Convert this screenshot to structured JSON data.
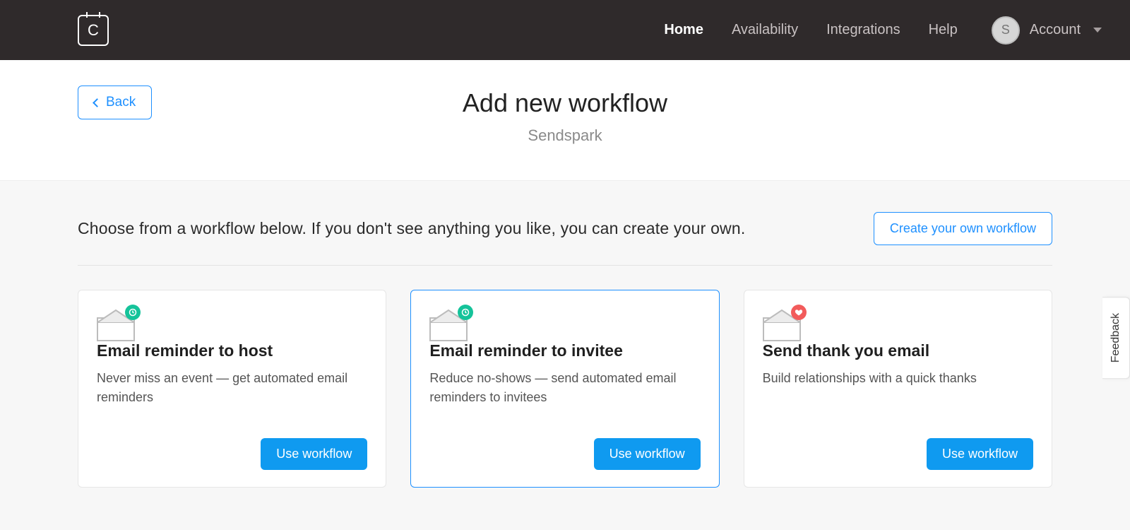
{
  "logo_letter": "C",
  "nav": {
    "items": [
      {
        "label": "Home",
        "active": true
      },
      {
        "label": "Availability",
        "active": false
      },
      {
        "label": "Integrations",
        "active": false
      },
      {
        "label": "Help",
        "active": false
      }
    ],
    "account": {
      "avatar_initial": "S",
      "label": "Account"
    }
  },
  "header": {
    "back_label": "Back",
    "title": "Add new workflow",
    "subtitle": "Sendspark"
  },
  "content": {
    "prompt": "Choose from a workflow below. If you don't see anything you like, you can create your own.",
    "create_own_label": "Create your own workflow",
    "use_workflow_label": "Use workflow",
    "cards": [
      {
        "title": "Email reminder to host",
        "desc": "Never miss an event — get automated email reminders",
        "badge": "clock",
        "selected": false
      },
      {
        "title": "Email reminder to invitee",
        "desc": "Reduce no-shows — send automated email reminders to invitees",
        "badge": "clock",
        "selected": true
      },
      {
        "title": "Send thank you email",
        "desc": "Build relationships with a quick thanks",
        "badge": "heart",
        "selected": false
      }
    ]
  },
  "feedback_label": "Feedback"
}
